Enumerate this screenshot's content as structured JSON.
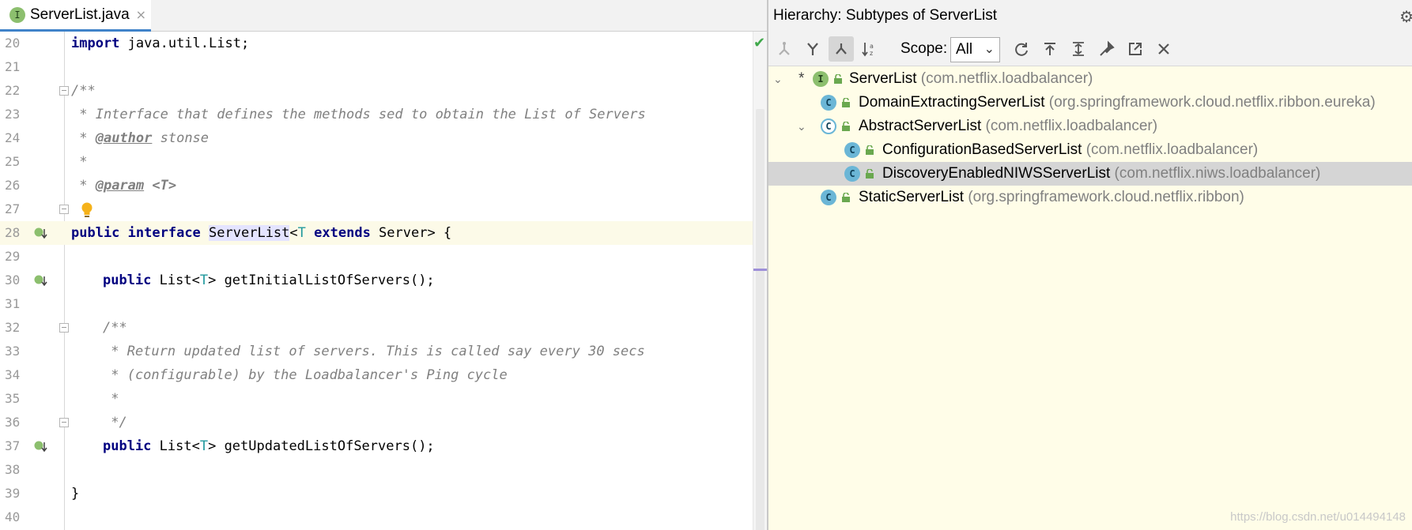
{
  "editor": {
    "tab": {
      "badge": "I",
      "label": "ServerList.java",
      "close": "×"
    },
    "lines": [
      {
        "no": "20"
      },
      {
        "no": "21"
      },
      {
        "no": "22"
      },
      {
        "no": "23"
      },
      {
        "no": "24"
      },
      {
        "no": "25"
      },
      {
        "no": "26"
      },
      {
        "no": "27"
      },
      {
        "no": "28"
      },
      {
        "no": "29"
      },
      {
        "no": "30"
      },
      {
        "no": "31"
      },
      {
        "no": "32"
      },
      {
        "no": "33"
      },
      {
        "no": "34"
      },
      {
        "no": "35"
      },
      {
        "no": "36"
      },
      {
        "no": "37"
      },
      {
        "no": "38"
      },
      {
        "no": "39"
      },
      {
        "no": "40"
      }
    ],
    "code": {
      "l20_kw": "import",
      "l20_rest": " java.util.List;",
      "l22": "/**",
      "l23": " * Interface that defines the methods sed to obtain the List of Servers",
      "l24_pre": " * ",
      "l24_tag": "@author",
      "l24_post": " stonse",
      "l25": " *",
      "l26_pre": " * ",
      "l26_tag": "@param",
      "l26_post": " <T>",
      "l28_kw1": "public",
      "l28_kw2": "interface",
      "l28_name": "ServerList",
      "l28_lt": "<",
      "l28_t": "T",
      "l28_kw3": "extends",
      "l28_rest": " Server> {",
      "l30_kw": "public",
      "l30_a": " List<",
      "l30_t": "T",
      "l30_b": "> getInitialListOfServers();",
      "l32": "/**",
      "l33": " * Return updated list of servers. This is called say every 30 secs",
      "l34": " * (configurable) by the Loadbalancer's Ping cycle",
      "l35": " *",
      "l36": " */",
      "l37_kw": "public",
      "l37_a": " List<",
      "l37_t": "T",
      "l37_b": "> getUpdatedListOfServers();",
      "l39": "}"
    }
  },
  "hierarchy": {
    "title": "Hierarchy:  Subtypes of ServerList",
    "scope_label": "Scope:",
    "scope_value": "All",
    "tree": [
      {
        "icon": "I",
        "name": "ServerList",
        "pkg": " (com.netflix.loadbalancer)",
        "toggle": "⌄",
        "star": "*"
      },
      {
        "icon": "C",
        "name": "DomainExtractingServerList",
        "pkg": " (org.springframework.cloud.netflix.ribbon.eureka)"
      },
      {
        "icon": "C",
        "name": "AbstractServerList",
        "pkg": " (com.netflix.loadbalancer)",
        "toggle": "⌄"
      },
      {
        "icon": "C",
        "name": "ConfigurationBasedServerList",
        "pkg": " (com.netflix.loadbalancer)"
      },
      {
        "icon": "C",
        "name": "DiscoveryEnabledNIWSServerList",
        "pkg": " (com.netflix.niws.loadbalancer)"
      },
      {
        "icon": "C",
        "name": "StaticServerList",
        "pkg": " (org.springframework.cloud.netflix.ribbon)"
      }
    ]
  },
  "watermark": "https://blog.csdn.net/u014494148",
  "icons": {
    "tab": "interface-icon",
    "gutter": "implemented-method-icon",
    "bulb": "lightbulb-icon",
    "check": "check-icon",
    "gear": "gear-icon"
  },
  "colors": {
    "keyword": "#000080",
    "comment": "#808080",
    "type_param": "#20999d",
    "current_line": "#fcfae8",
    "hierarchy_bg": "#fffde8",
    "selection": "#d5d5d5"
  }
}
